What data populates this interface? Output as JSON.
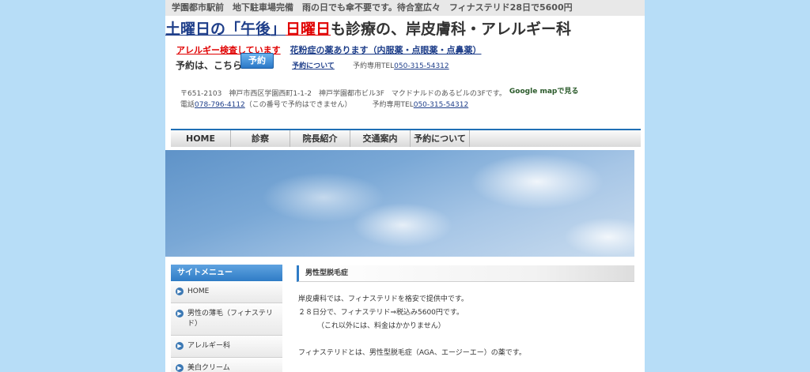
{
  "topbar": {
    "text": "学園都市駅前　地下駐車場完備　雨の日でも傘不要です。待合室広々　フィナステリド28日で5600円"
  },
  "headline": {
    "part1": "土曜日の「午後」",
    "part2": "日曜日",
    "part3": "も診療の、岸皮膚科・アレルギー科"
  },
  "subline": {
    "allergy": "アレルギー検査しています",
    "pollen": "花粉症の薬あります（内服薬・点眼薬・点鼻薬）"
  },
  "reservation": {
    "label": "予約は、こちら",
    "button": "予約",
    "about_link": "予約について",
    "tel_label": "予約専用TEL",
    "tel": "050-315-54312"
  },
  "address": {
    "line1": "〒651-2103　神戸市西区学園西町1-1-2　神戸学園都市ビル3F　マクドナルドのあるビルの3Fです。",
    "google_map": "Google mapで見る",
    "phone_label": "電話",
    "phone": "078-796-4112",
    "phone_note": "（この番号で予約はできません）",
    "tel_label": "予約専用TEL",
    "tel": "050-315-54312"
  },
  "nav": {
    "items": [
      "HOME",
      "診察",
      "院長紹介",
      "交通案内",
      "予約について"
    ]
  },
  "sidebar": {
    "title": "サイトメニュー",
    "items": [
      "HOME",
      "男性の薄毛（フィナステリド）",
      "アレルギー科",
      "美白クリーム"
    ]
  },
  "content": {
    "title": "男性型脱毛症",
    "line1": "岸皮膚科では、フィナステリドを格安で提供中です。",
    "line2": "２８日分で、フィナステリド⇒税込み5600円です。",
    "line3": "（これ以外には、料金はかかりません）",
    "line4": "フィナステリドとは、男性型脱毛症（AGA、エージーエー）の薬です。"
  }
}
